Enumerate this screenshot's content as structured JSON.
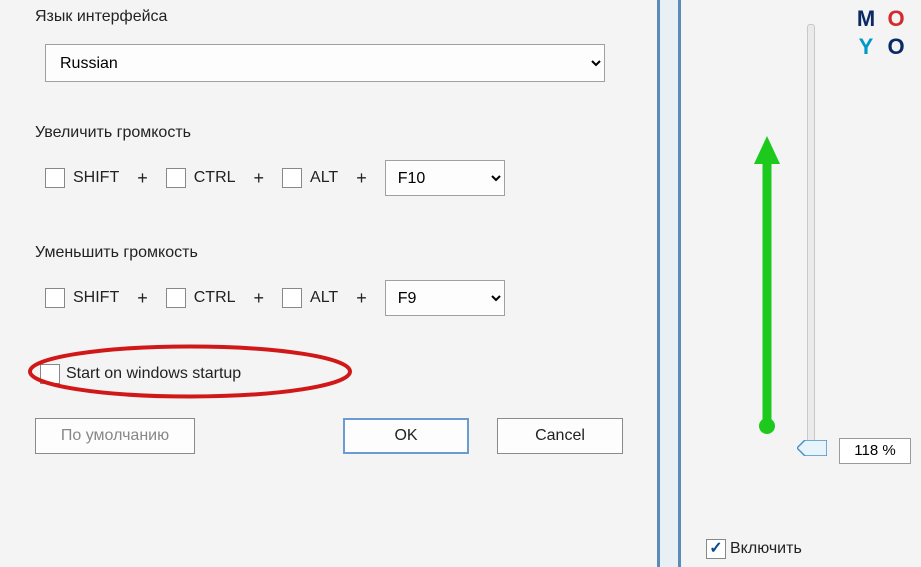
{
  "settings": {
    "lang_label": "Язык интерфейса",
    "lang_value": "Russian",
    "increase_label": "Увеличить громкость",
    "decrease_label": "Уменьшить громкость",
    "keys": {
      "shift": "SHIFT",
      "ctrl": "CTRL",
      "alt": "ALT"
    },
    "plus": "+",
    "hotkey_increase": "F10",
    "hotkey_decrease": "F9",
    "startup_label": "Start on windows startup",
    "default_btn": "По умолчанию",
    "ok_btn": "OK",
    "cancel_btn": "Cancel"
  },
  "volume": {
    "value_display": "118 %",
    "enable_label": "Включить"
  },
  "logo": {
    "m": "M",
    "o1": "O",
    "y": "Y",
    "o2": "O"
  }
}
